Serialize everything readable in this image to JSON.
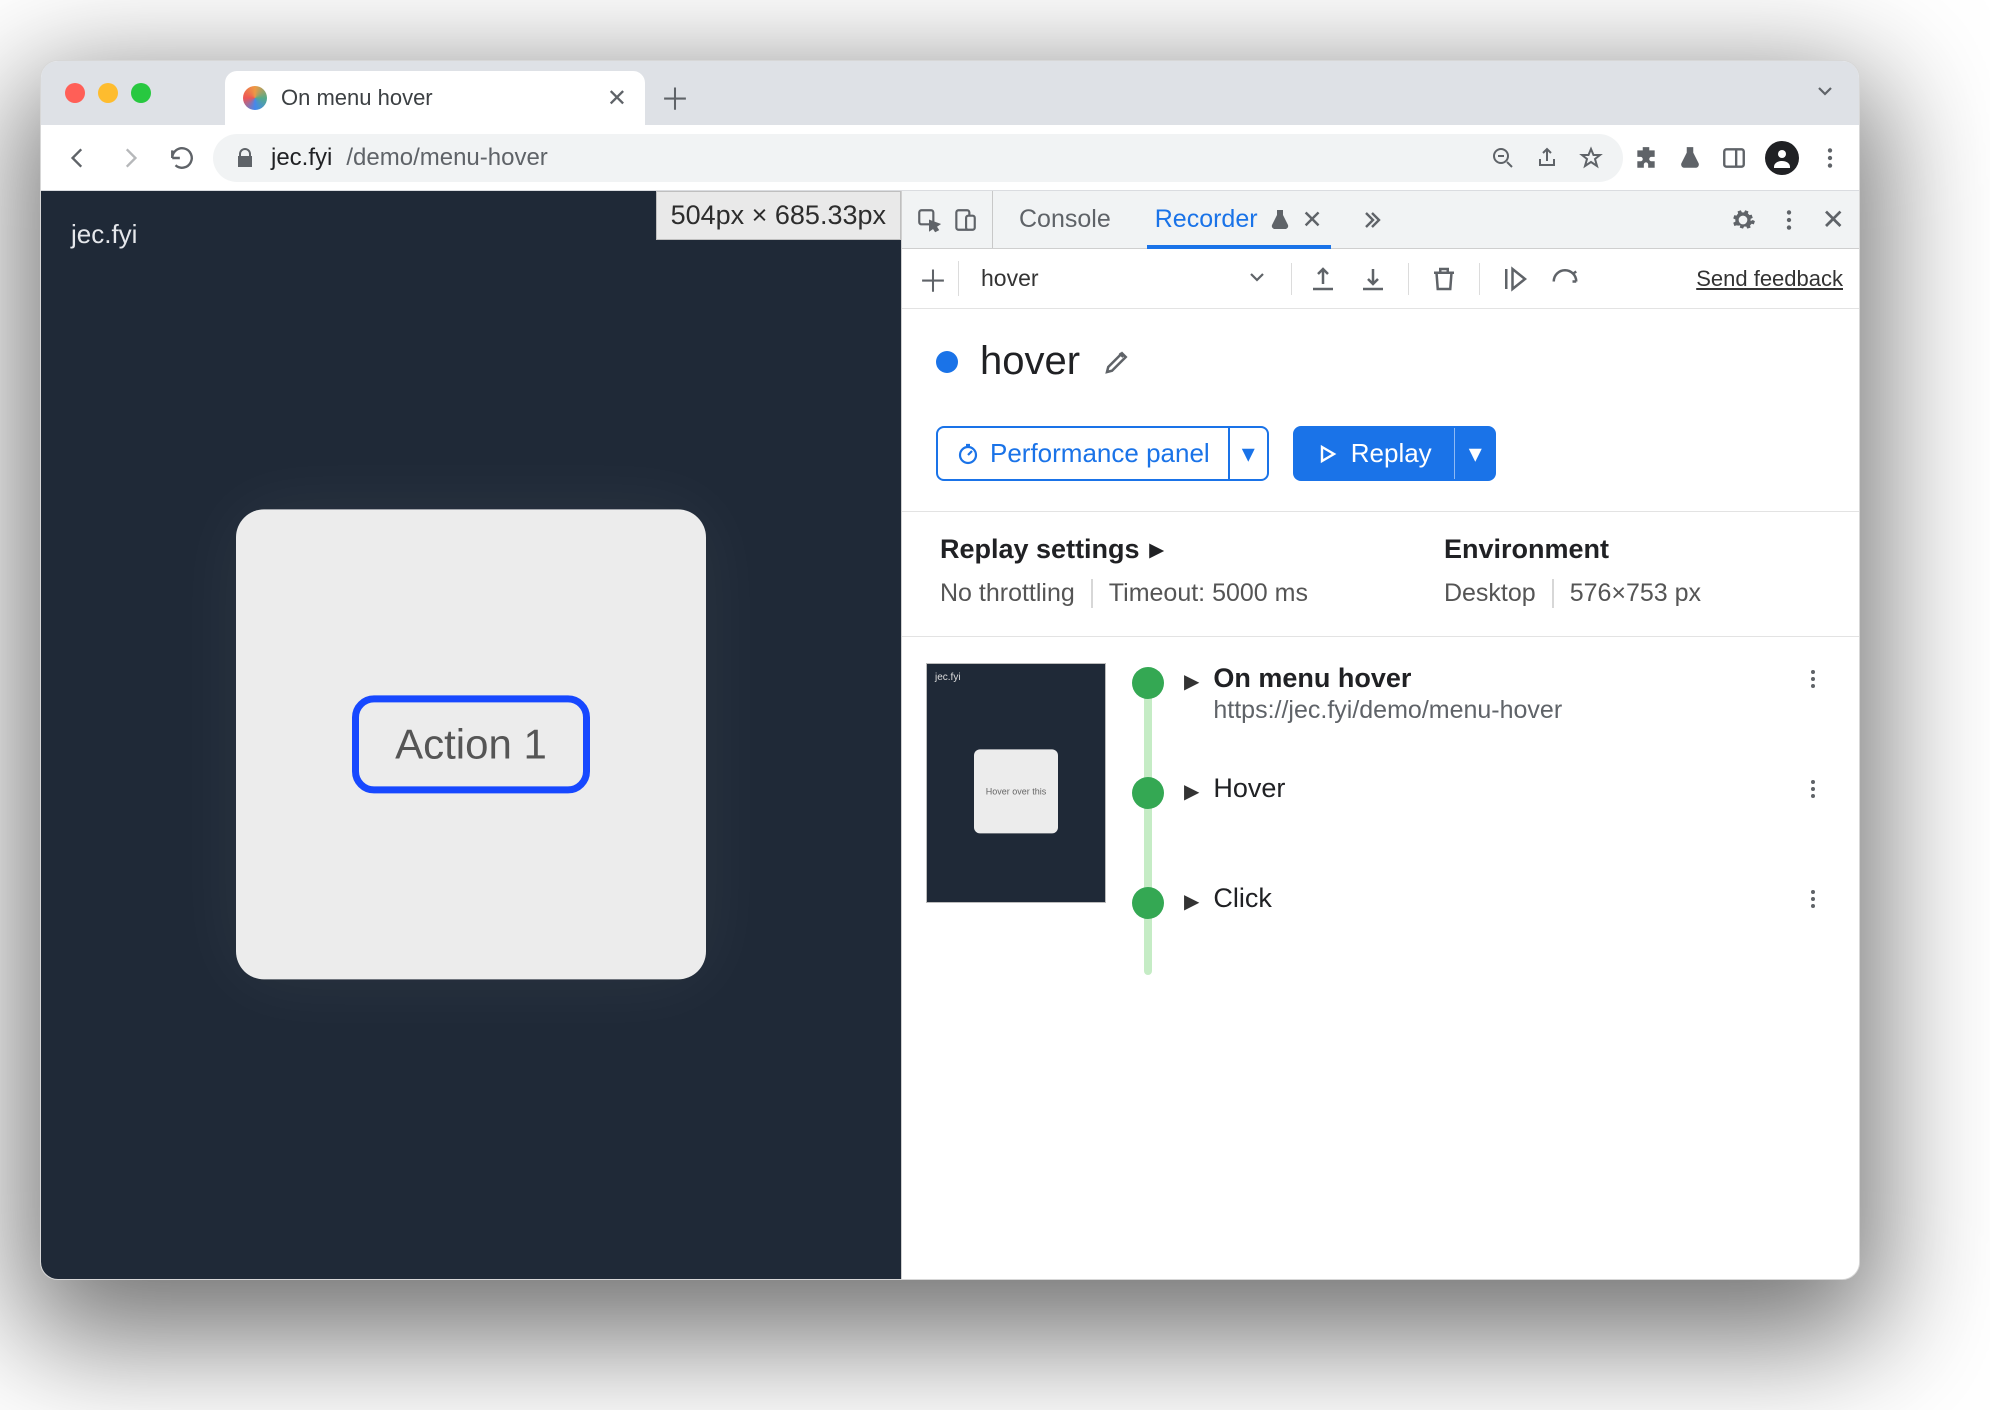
{
  "browser": {
    "tab_title": "On menu hover",
    "url_host": "jec.fyi",
    "url_path": "/demo/menu-hover"
  },
  "page": {
    "brand": "jec.fyi",
    "dimensions_badge": "504px × 685.33px",
    "action_button": "Action 1"
  },
  "devtools": {
    "tabs": {
      "console": "Console",
      "recorder": "Recorder"
    },
    "send_feedback": "Send feedback",
    "recorder_toolbar": {
      "recording_name": "hover"
    },
    "recorder": {
      "title": "hover",
      "perf_button": "Performance panel",
      "replay_button": "Replay",
      "settings": {
        "replay_heading": "Replay settings",
        "throttling": "No throttling",
        "timeout": "Timeout: 5000 ms",
        "env_heading": "Environment",
        "device": "Desktop",
        "viewport": "576×753 px"
      },
      "steps": [
        {
          "title": "On menu hover",
          "subtitle": "https://jec.fyi/demo/menu-hover"
        },
        {
          "title": "Hover"
        },
        {
          "title": "Click"
        }
      ]
    }
  }
}
